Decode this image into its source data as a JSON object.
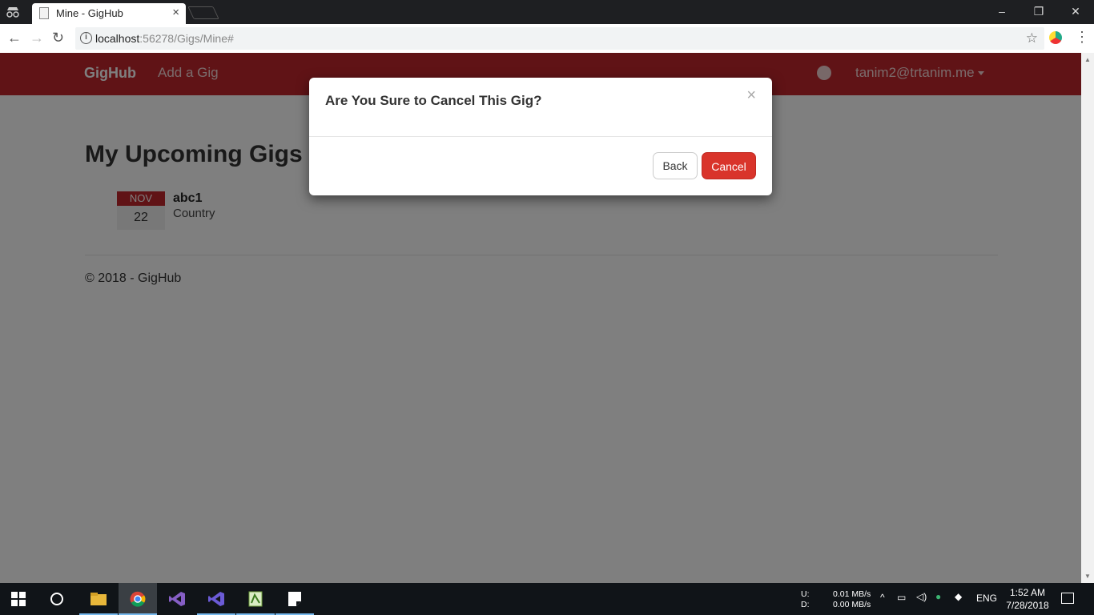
{
  "browser": {
    "tab_title": "Mine - GigHub",
    "tab_close": "×",
    "url_host": "localhost",
    "url_path": ":56278/Gigs/Mine#",
    "window_controls": {
      "minimize": "–",
      "maximize": "❐",
      "close": "✕"
    },
    "icons": {
      "back": "←",
      "forward": "→",
      "reload": "↻",
      "star": "☆",
      "menu": "⋮",
      "info": "i"
    }
  },
  "site": {
    "brand": "GigHub",
    "nav_add_gig": "Add a Gig",
    "user_email": "tanim2@trtanim.me",
    "heading": "My Upcoming Gigs",
    "gigs": [
      {
        "month": "NOV",
        "day": "22",
        "artist": "abc1",
        "genre": "Country"
      }
    ],
    "footer": "© 2018 - GigHub",
    "brand_color": "#c0272d"
  },
  "modal": {
    "title": "Are You Sure to Cancel This Gig?",
    "close": "×",
    "back_label": "Back",
    "cancel_label": "Cancel"
  },
  "taskbar": {
    "net_upload_label": "U:",
    "net_download_label": "D:",
    "net_upload_speed": "0.01 MB/s",
    "net_download_speed": "0.00 MB/s",
    "tray_chevron": "^",
    "language": "ENG",
    "time": "1:52 AM",
    "date": "7/28/2018",
    "apps": [
      "file-explorer",
      "chrome",
      "visual-studio",
      "visual-studio-preview",
      "notepad-plus-plus",
      "sticky-notes"
    ]
  }
}
